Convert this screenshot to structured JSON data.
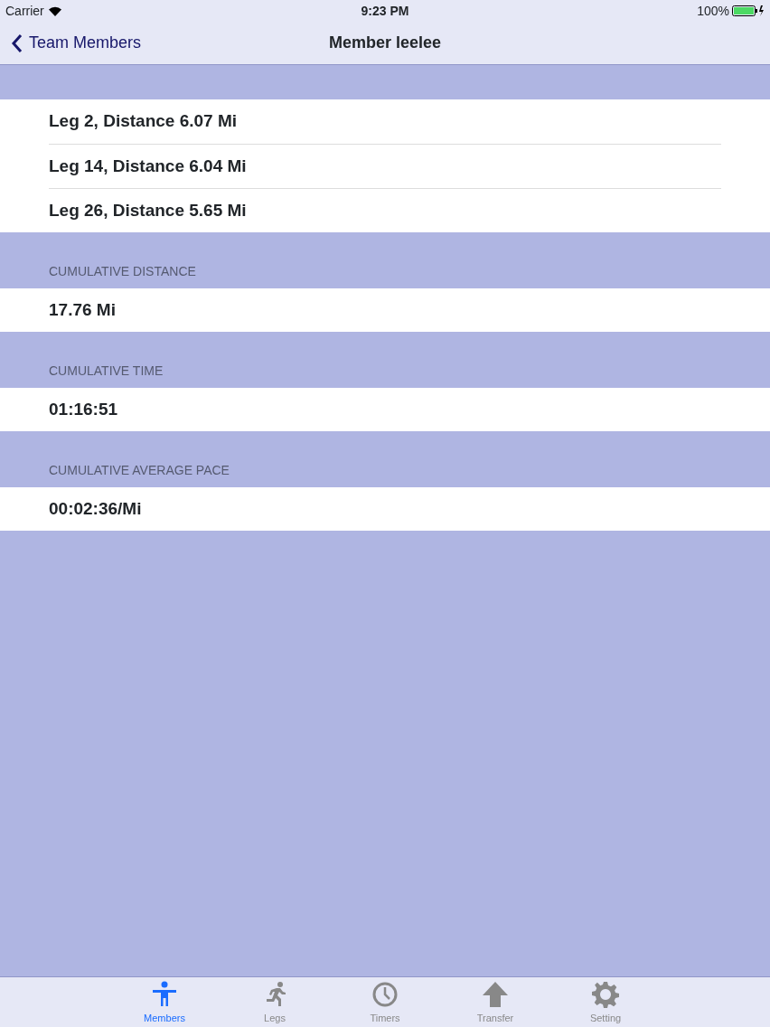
{
  "status_bar": {
    "carrier": "Carrier",
    "time": "9:23 PM",
    "battery": "100%"
  },
  "nav": {
    "back": "Team Members",
    "title": "Member leelee"
  },
  "legs": [
    "Leg 2, Distance 6.07 Mi",
    "Leg 14, Distance 6.04 Mi",
    "Leg 26, Distance 5.65 Mi"
  ],
  "sections": [
    {
      "header": "CUMULATIVE DISTANCE",
      "value": "17.76 Mi"
    },
    {
      "header": "CUMULATIVE TIME",
      "value": "01:16:51"
    },
    {
      "header": "CUMULATIVE AVERAGE PACE",
      "value": "00:02:36/Mi"
    }
  ],
  "tabs": [
    {
      "label": "Members",
      "kind": "person",
      "selected": true
    },
    {
      "label": "Legs",
      "kind": "runner",
      "selected": false
    },
    {
      "label": "Timers",
      "kind": "clock",
      "selected": false
    },
    {
      "label": "Transfer",
      "kind": "arrow",
      "selected": false
    },
    {
      "label": "Setting",
      "kind": "gear",
      "selected": false
    }
  ]
}
